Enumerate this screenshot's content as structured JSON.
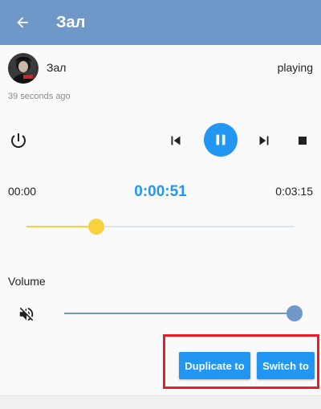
{
  "appbar": {
    "title": "Зал",
    "back_icon": "arrow-left-icon",
    "background": "#6f97c8"
  },
  "device": {
    "name": "Зал",
    "status": "playing",
    "last_seen": "39 seconds ago",
    "avatar_icon": "album-art-avatar"
  },
  "controls": {
    "power_icon": "power-icon",
    "previous_icon": "skip-previous-icon",
    "pause_icon": "pause-icon",
    "next_icon": "skip-next-icon",
    "stop_icon": "stop-icon",
    "accent": "#2196f3"
  },
  "progress": {
    "start": "00:00",
    "current": "0:00:51",
    "total": "0:03:15",
    "position_seconds": 51,
    "duration_seconds": 195,
    "color": "#f7d23e"
  },
  "volume": {
    "label": "Volume",
    "mute_icon": "volume-off-icon",
    "level": 1.0,
    "color": "#6f97c8"
  },
  "actions": {
    "duplicate_label": "Duplicate to",
    "switch_label": "Switch to",
    "highlight_color": "#ea1c24"
  }
}
